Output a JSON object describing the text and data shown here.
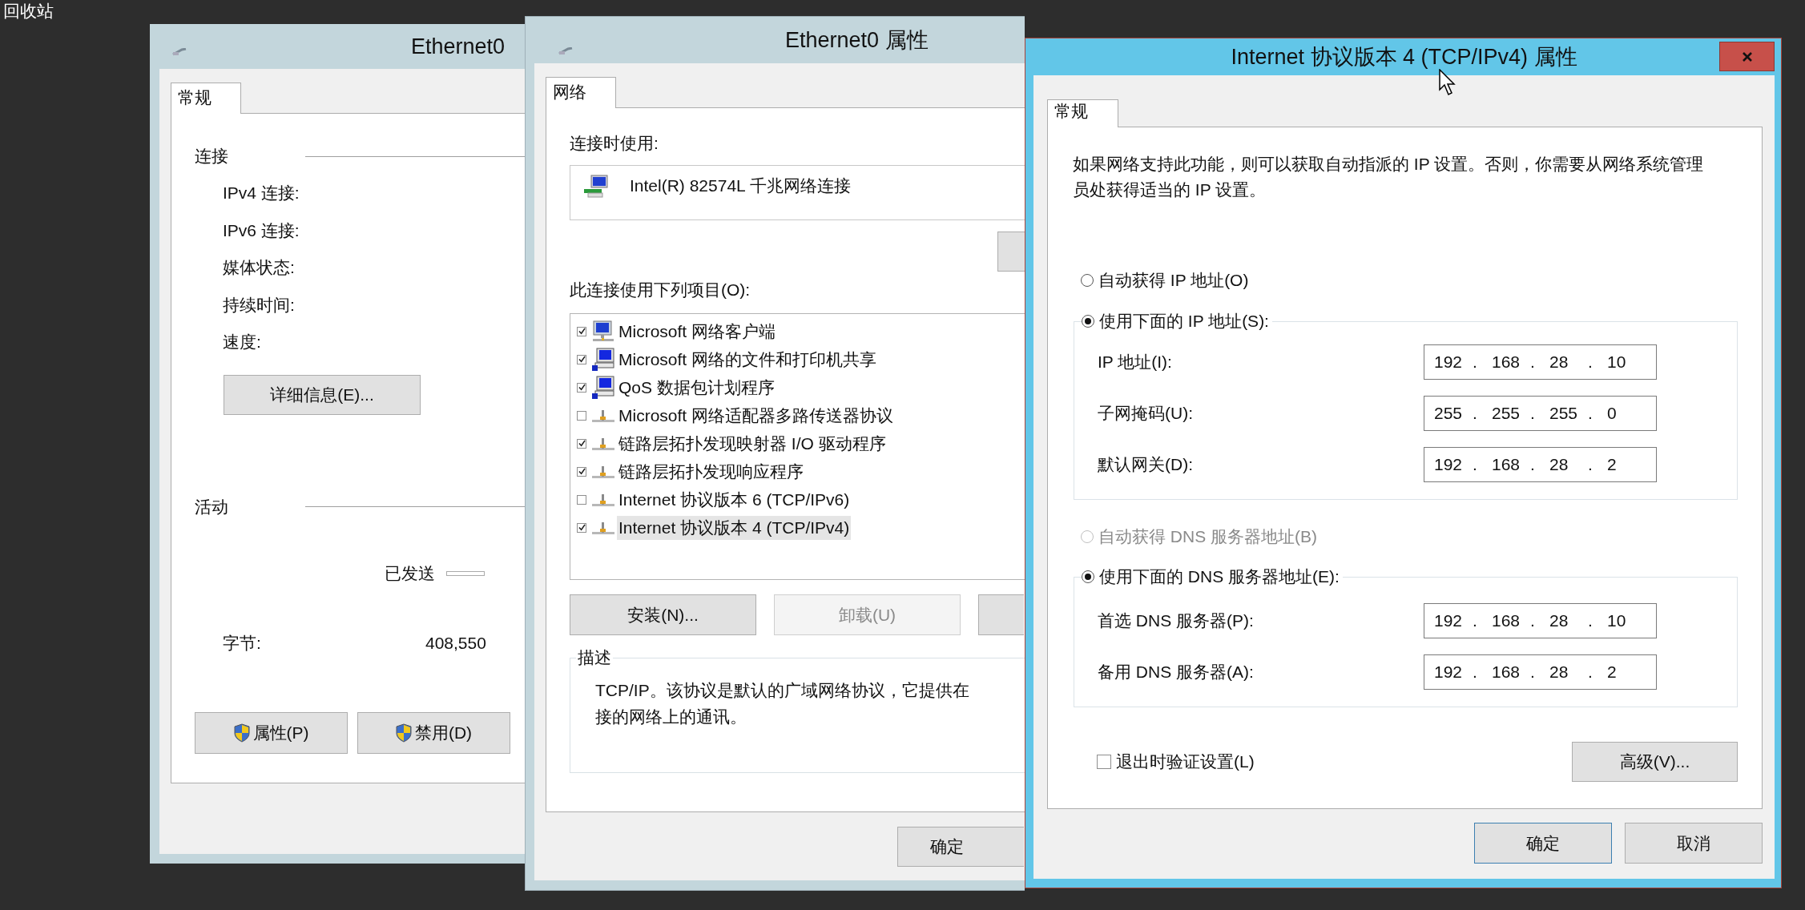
{
  "desktop": {
    "icon_label": "回收站"
  },
  "status_window": {
    "title": "Ethernet0",
    "tabs": [
      {
        "label": "常规",
        "selected": true
      }
    ],
    "connection": {
      "heading": "连接",
      "rows": [
        "IPv4 连接:",
        "IPv6 连接:",
        "媒体状态:",
        "持续时间:",
        "速度:"
      ]
    },
    "details_button": "详细信息(E)...",
    "activity": {
      "heading": "活动",
      "sent_label": "已发送",
      "bytes_label": "字节:",
      "bytes_sent": "408,550"
    },
    "buttons": [
      "属性(P)",
      "禁用(D)"
    ]
  },
  "properties_window": {
    "title": "Ethernet0 属性",
    "tabs": [
      {
        "label": "网络",
        "selected": true
      }
    ],
    "connect_using_label": "连接时使用:",
    "adapter": "Intel(R) 82574L 千兆网络连接",
    "items_label": "此连接使用下列项目(O):",
    "items": [
      {
        "label": "Microsoft 网络客户端",
        "checked": true,
        "selected": false,
        "kind": "client"
      },
      {
        "label": "Microsoft 网络的文件和打印机共享",
        "checked": true,
        "selected": false,
        "kind": "service"
      },
      {
        "label": "QoS 数据包计划程序",
        "checked": true,
        "selected": false,
        "kind": "service"
      },
      {
        "label": "Microsoft 网络适配器多路传送器协议",
        "checked": false,
        "selected": false,
        "kind": "protocol"
      },
      {
        "label": "链路层拓扑发现映射器 I/O 驱动程序",
        "checked": true,
        "selected": false,
        "kind": "protocol"
      },
      {
        "label": "链路层拓扑发现响应程序",
        "checked": true,
        "selected": false,
        "kind": "protocol"
      },
      {
        "label": "Internet 协议版本 6 (TCP/IPv6)",
        "checked": false,
        "selected": false,
        "kind": "protocol"
      },
      {
        "label": "Internet 协议版本 4 (TCP/IPv4)",
        "checked": true,
        "selected": true,
        "kind": "protocol"
      }
    ],
    "buttons": [
      {
        "label": "安装(N)...",
        "disabled": false
      },
      {
        "label": "卸载(U)",
        "disabled": true
      }
    ],
    "description": {
      "heading": "描述",
      "lines": [
        "TCP/IP。该协议是默认的广域网络协议，它提供在",
        "接的网络上的通讯。"
      ]
    },
    "ok_button": "确定"
  },
  "ipv4_window": {
    "title": "Internet 协议版本 4 (TCP/IPv4) 属性",
    "tabs": [
      {
        "label": "常规",
        "selected": true
      }
    ],
    "intro": "如果网络支持此功能，则可以获取自动指派的 IP 设置。否则，你需要从网络系统管理员处获得适当的 IP 设置。",
    "octet_separator": ".",
    "ip_mode": [
      {
        "label": "自动获得 IP 地址(O)",
        "selected": false,
        "disabled": false
      },
      {
        "label": "使用下面的 IP 地址(S):",
        "selected": true,
        "disabled": false
      }
    ],
    "ip_fields": [
      {
        "label": "IP 地址(I):",
        "octets": [
          "192",
          "168",
          "28",
          "10"
        ]
      },
      {
        "label": "子网掩码(U):",
        "octets": [
          "255",
          "255",
          "255",
          "0"
        ]
      },
      {
        "label": "默认网关(D):",
        "octets": [
          "192",
          "168",
          "28",
          "2"
        ]
      }
    ],
    "dns_mode": [
      {
        "label": "自动获得 DNS 服务器地址(B)",
        "selected": false,
        "disabled": true
      },
      {
        "label": "使用下面的 DNS 服务器地址(E):",
        "selected": true,
        "disabled": false
      }
    ],
    "dns_fields": [
      {
        "label": "首选 DNS 服务器(P):",
        "octets": [
          "192",
          "168",
          "28",
          "10"
        ]
      },
      {
        "label": "备用 DNS 服务器(A):",
        "octets": [
          "192",
          "168",
          "28",
          "2"
        ]
      }
    ],
    "validate_checkbox": {
      "label": "退出时验证设置(L)",
      "checked": false
    },
    "advanced_button": "高级(V)...",
    "buttons": [
      {
        "label": "确定",
        "default": true
      },
      {
        "label": "取消",
        "default": false
      }
    ]
  }
}
